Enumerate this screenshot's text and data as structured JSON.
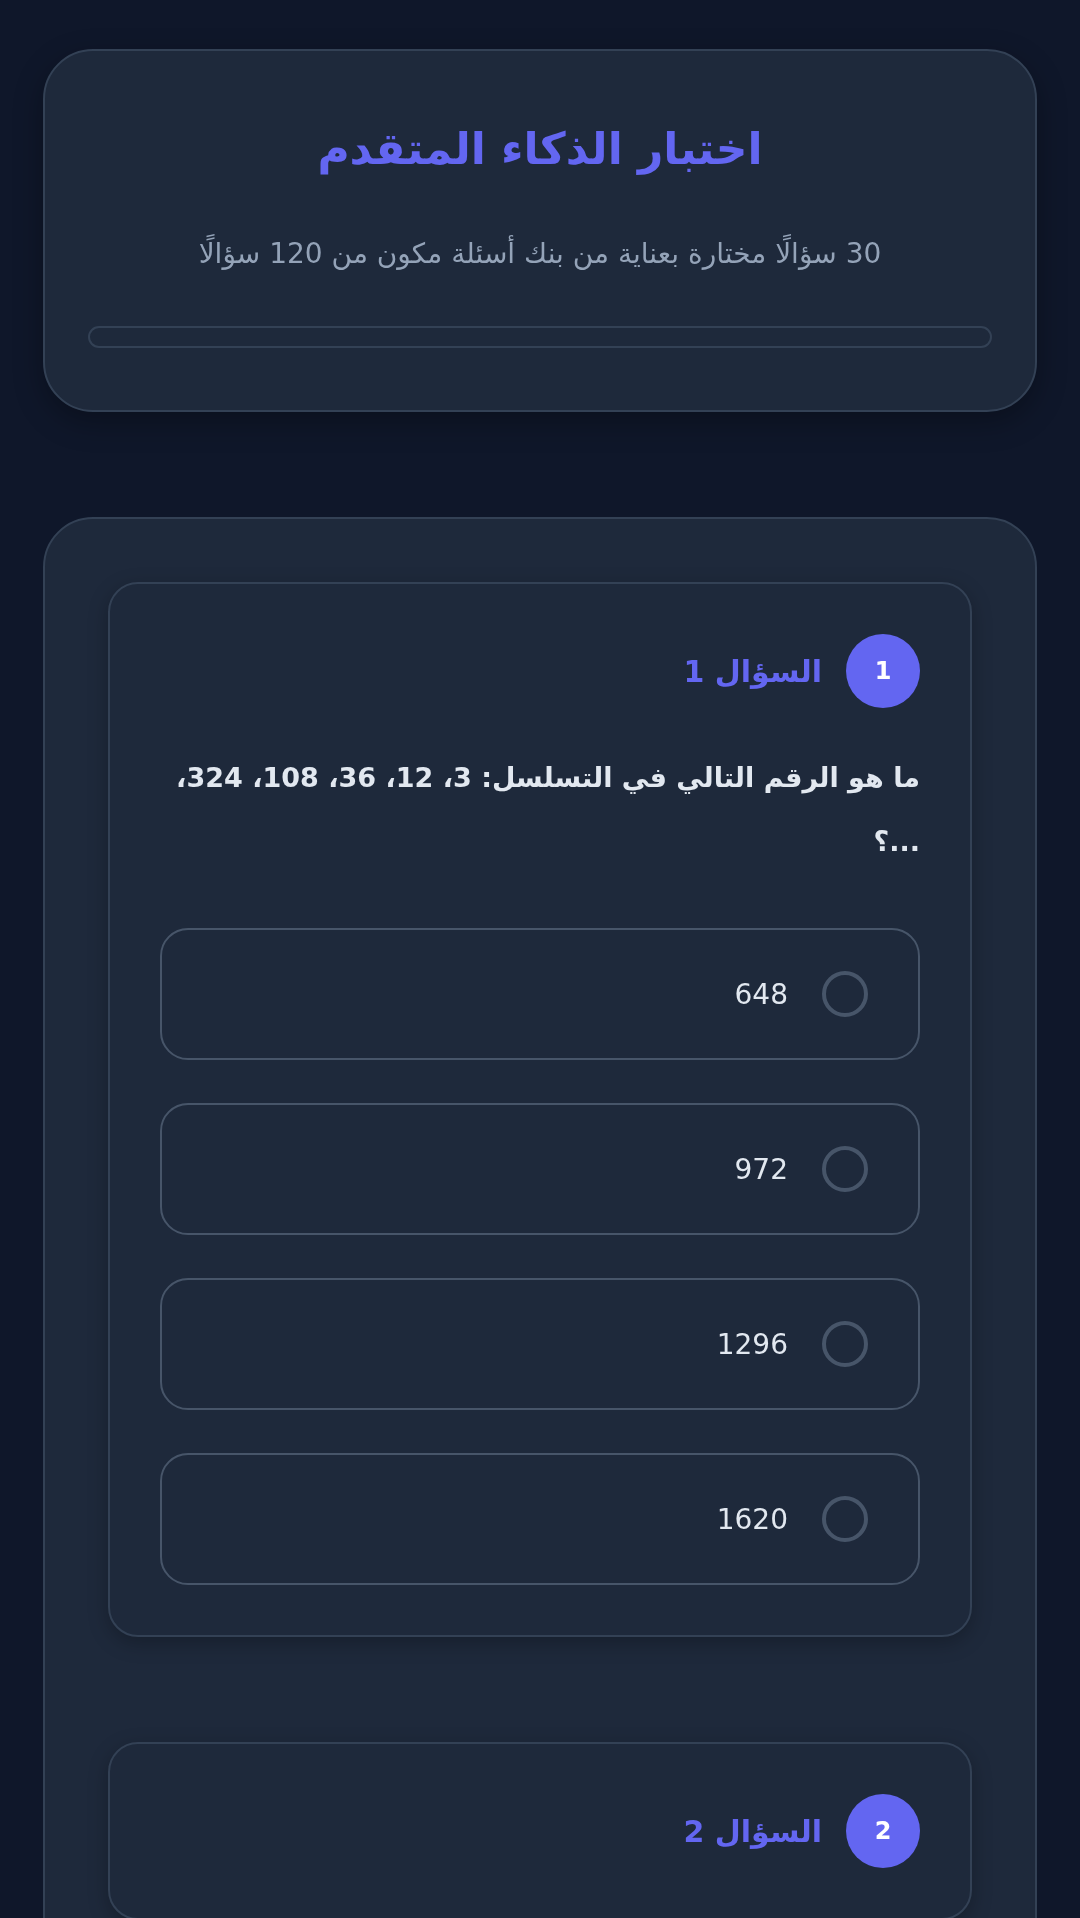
{
  "header": {
    "title": "اختبار الذكاء المتقدم",
    "subtitle": "30 سؤالًا مختارة بعناية من بنك أسئلة مكون من 120 سؤالًا",
    "progress": {
      "level": 0
    }
  },
  "questions": [
    {
      "number": "1",
      "label": "السؤال 1",
      "text": "ما هو الرقم التالي في التسلسل: 3، 12، 36، 108، 324، ...؟",
      "options": [
        {
          "label": "648",
          "selected": false
        },
        {
          "label": "972",
          "selected": false
        },
        {
          "label": "1296",
          "selected": false
        },
        {
          "label": "1620",
          "selected": false
        }
      ]
    },
    {
      "number": "2",
      "label": "السؤال 2"
    }
  ]
}
